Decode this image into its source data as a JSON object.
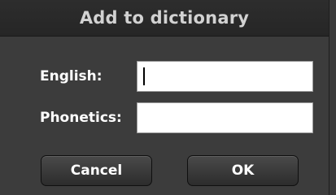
{
  "dialog": {
    "title": "Add to dictionary",
    "english_label": "English:",
    "english_value": "",
    "phonetics_label": "Phonetics:",
    "phonetics_value": "",
    "cancel_label": "Cancel",
    "ok_label": "OK"
  }
}
